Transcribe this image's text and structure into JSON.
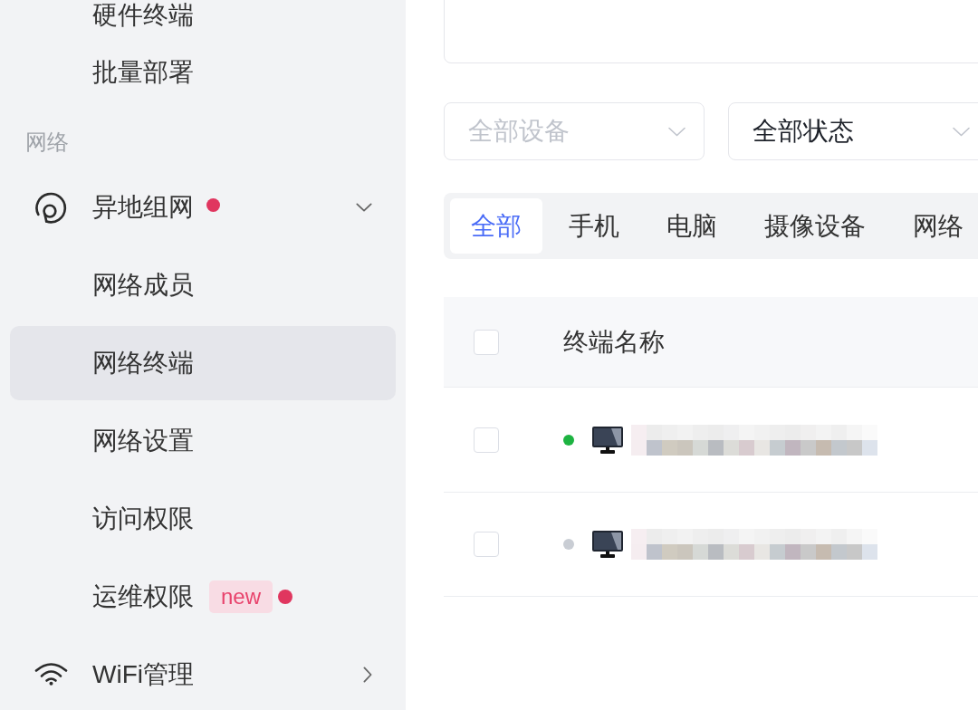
{
  "sidebar": {
    "items": [
      {
        "kind": "link",
        "label": "硬件终端",
        "selected": false
      },
      {
        "kind": "link",
        "label": "批量部署",
        "selected": false
      },
      {
        "kind": "section",
        "label": "网络"
      },
      {
        "kind": "group",
        "label": "异地组网",
        "dot": true,
        "expanded": true,
        "children": [
          {
            "label": "网络成员",
            "selected": false,
            "dot": false
          },
          {
            "label": "网络终端",
            "selected": true,
            "dot": false
          },
          {
            "label": "网络设置",
            "selected": false,
            "dot": false
          },
          {
            "label": "访问权限",
            "selected": false,
            "dot": false
          },
          {
            "label": "运维权限",
            "selected": false,
            "badge": "new",
            "dot": true
          }
        ]
      },
      {
        "kind": "group",
        "label": "WiFi管理",
        "dot": false,
        "expanded": false
      }
    ]
  },
  "filters": [
    {
      "placeholder": "全部设备"
    },
    {
      "value": "全部状态"
    }
  ],
  "tabs": [
    {
      "label": "全部",
      "selected": true
    },
    {
      "label": "手机",
      "selected": false
    },
    {
      "label": "电脑",
      "selected": false
    },
    {
      "label": "摄像设备",
      "selected": false
    },
    {
      "label": "网络",
      "selected": false
    }
  ],
  "table": {
    "select_all": {
      "checked": false
    },
    "columns": [
      {
        "label": "终端名称"
      }
    ],
    "rows": [
      {
        "checked": false,
        "color": "#1db341"
      },
      {
        "checked": false,
        "color": "#c9cdd4"
      }
    ]
  }
}
